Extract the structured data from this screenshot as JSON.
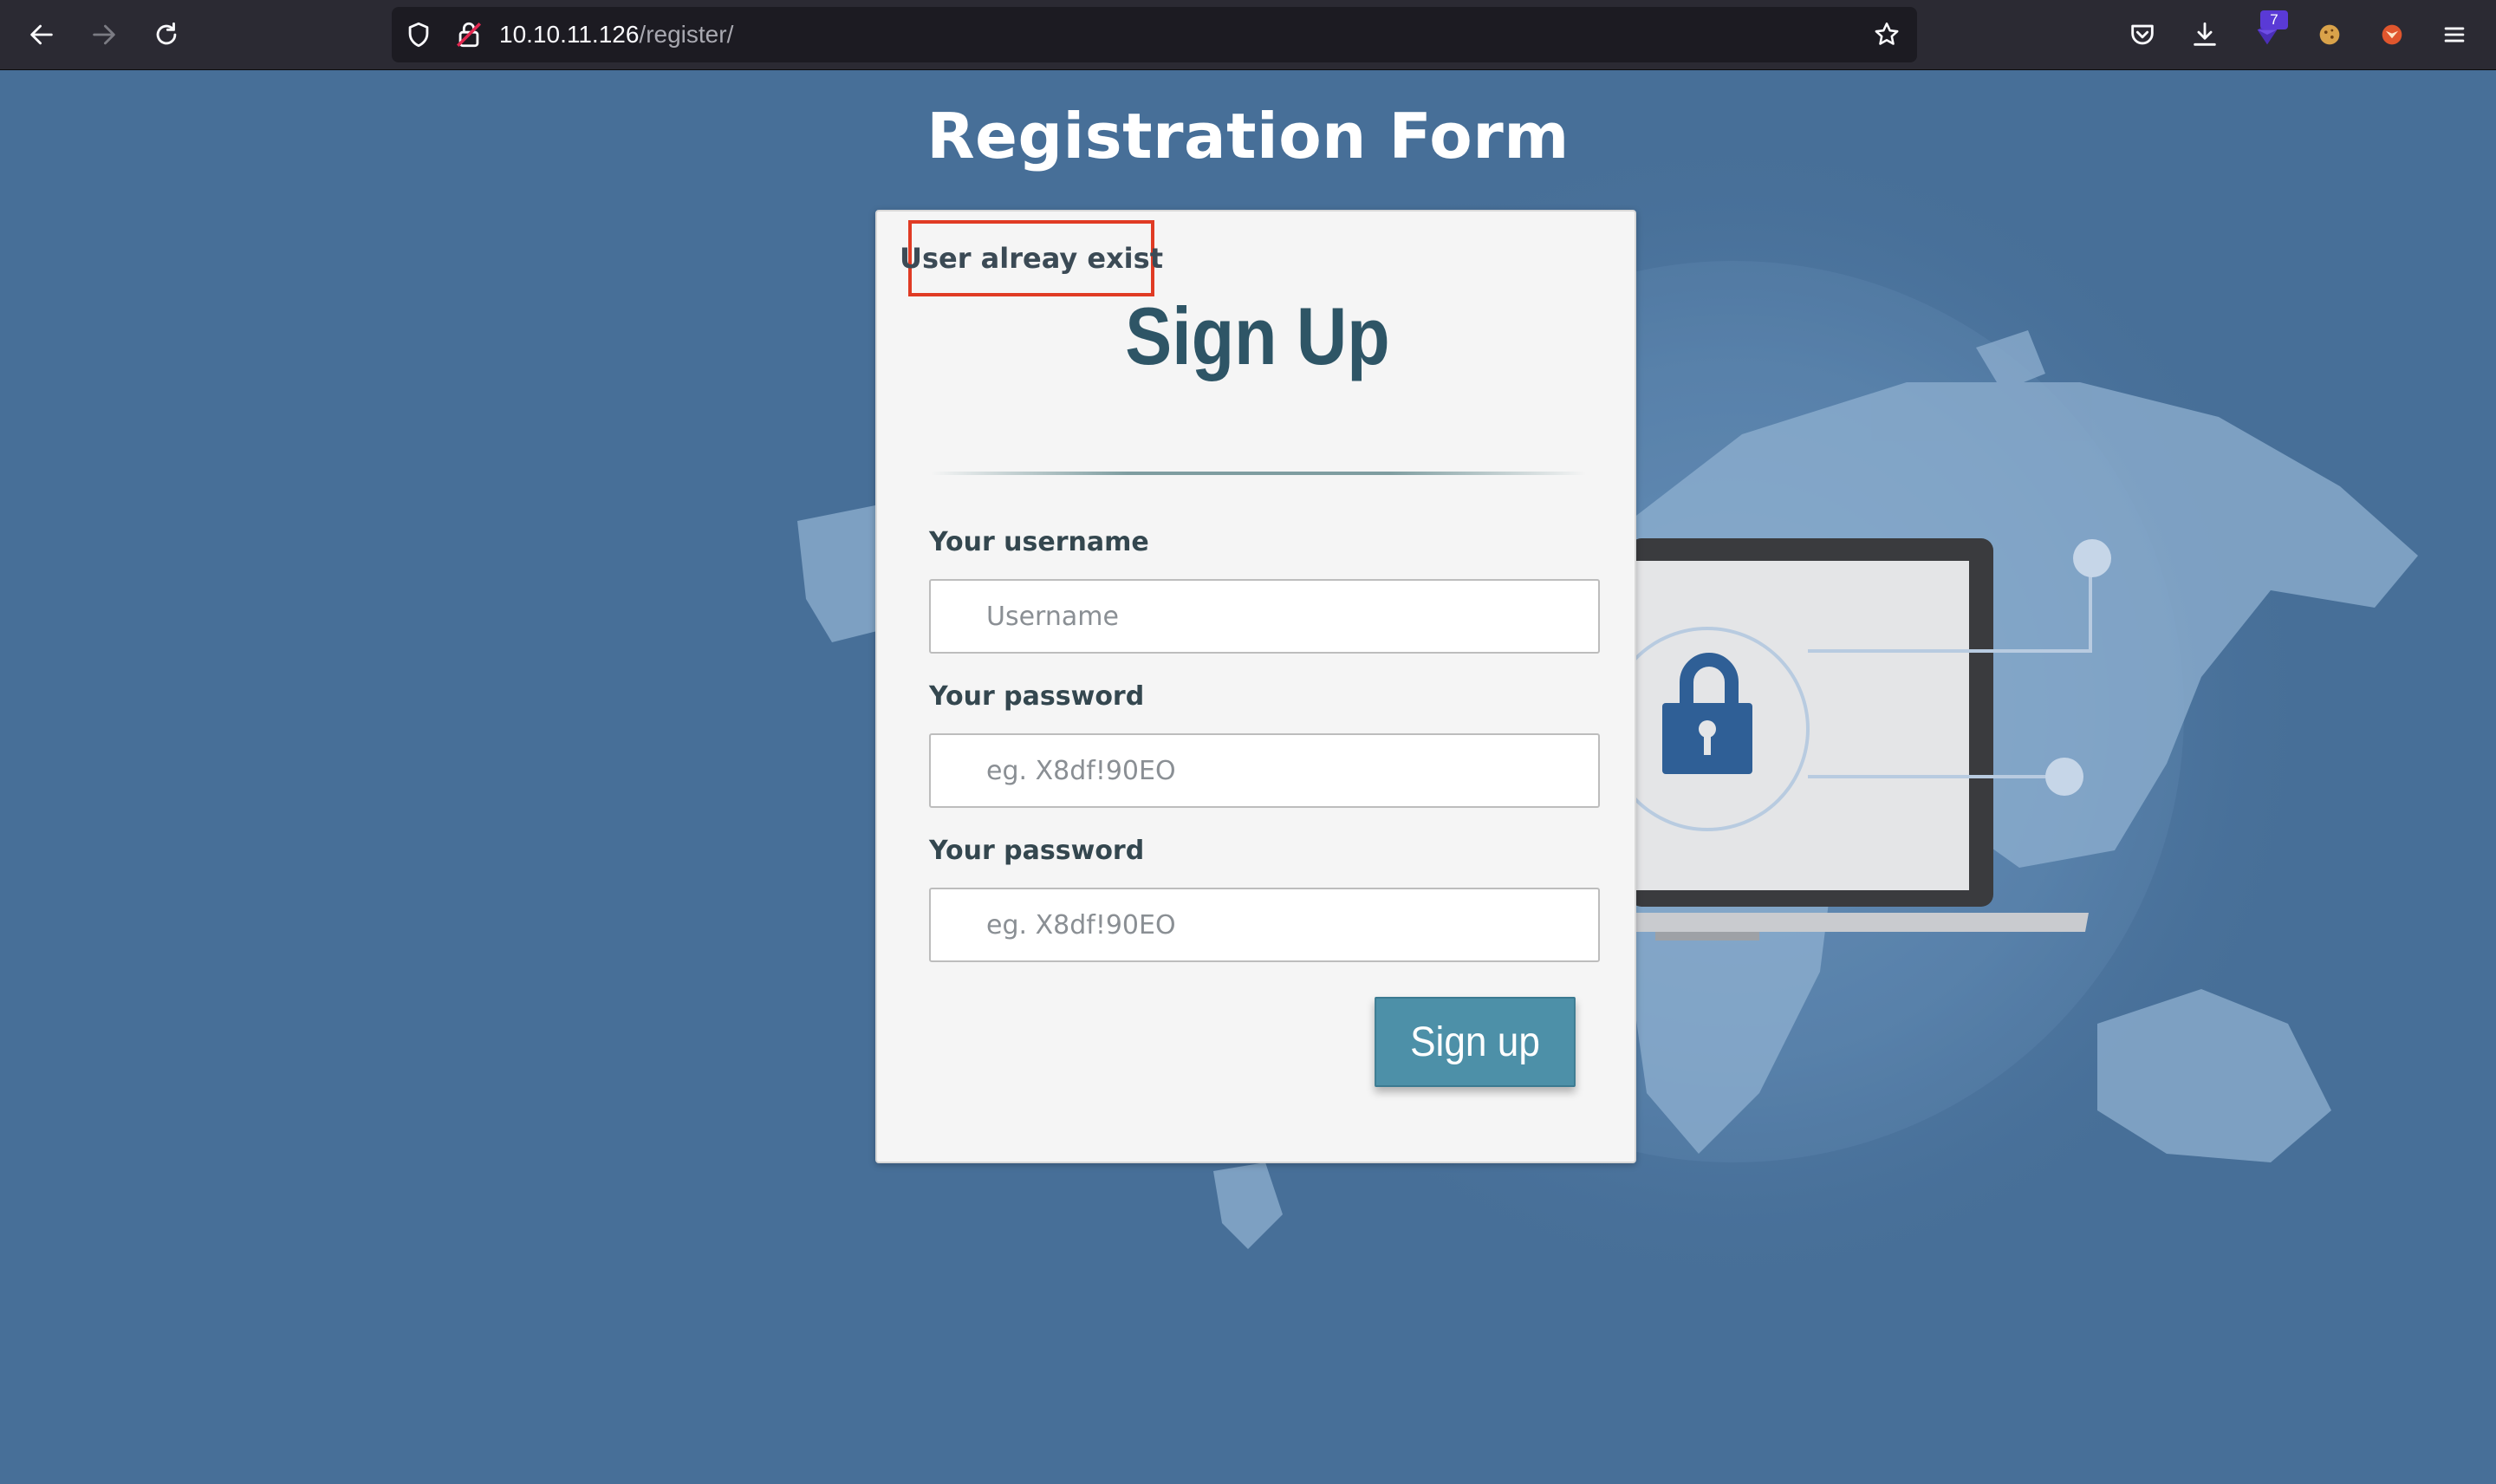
{
  "browser": {
    "url_host": "10.10.11.126",
    "url_path": "/register/",
    "extension_badge": "7",
    "icons": [
      "back-arrow-icon",
      "forward-arrow-icon",
      "reload-icon",
      "shield-icon",
      "insecure-lock-icon",
      "bookmark-star-icon",
      "pocket-icon",
      "download-icon",
      "extension-icon",
      "cookie-icon",
      "fox-icon",
      "hamburger-menu-icon"
    ]
  },
  "page": {
    "title": "Registration Form",
    "form": {
      "alert": "User alreay exist",
      "heading": "Sign Up",
      "username_label": "Your username",
      "username_placeholder": "Username",
      "password_label": "Your password",
      "password_placeholder": "eg. X8df!90EO",
      "confirm_label": "Your password",
      "confirm_placeholder": "eg. X8df!90EO",
      "submit_label": "Sign up"
    }
  },
  "colors": {
    "page_background": "#476f98",
    "alert_border": "#e03b24",
    "button": "#4d90a8",
    "heading": "#2e5566",
    "toolbar": "#2b2a33"
  }
}
